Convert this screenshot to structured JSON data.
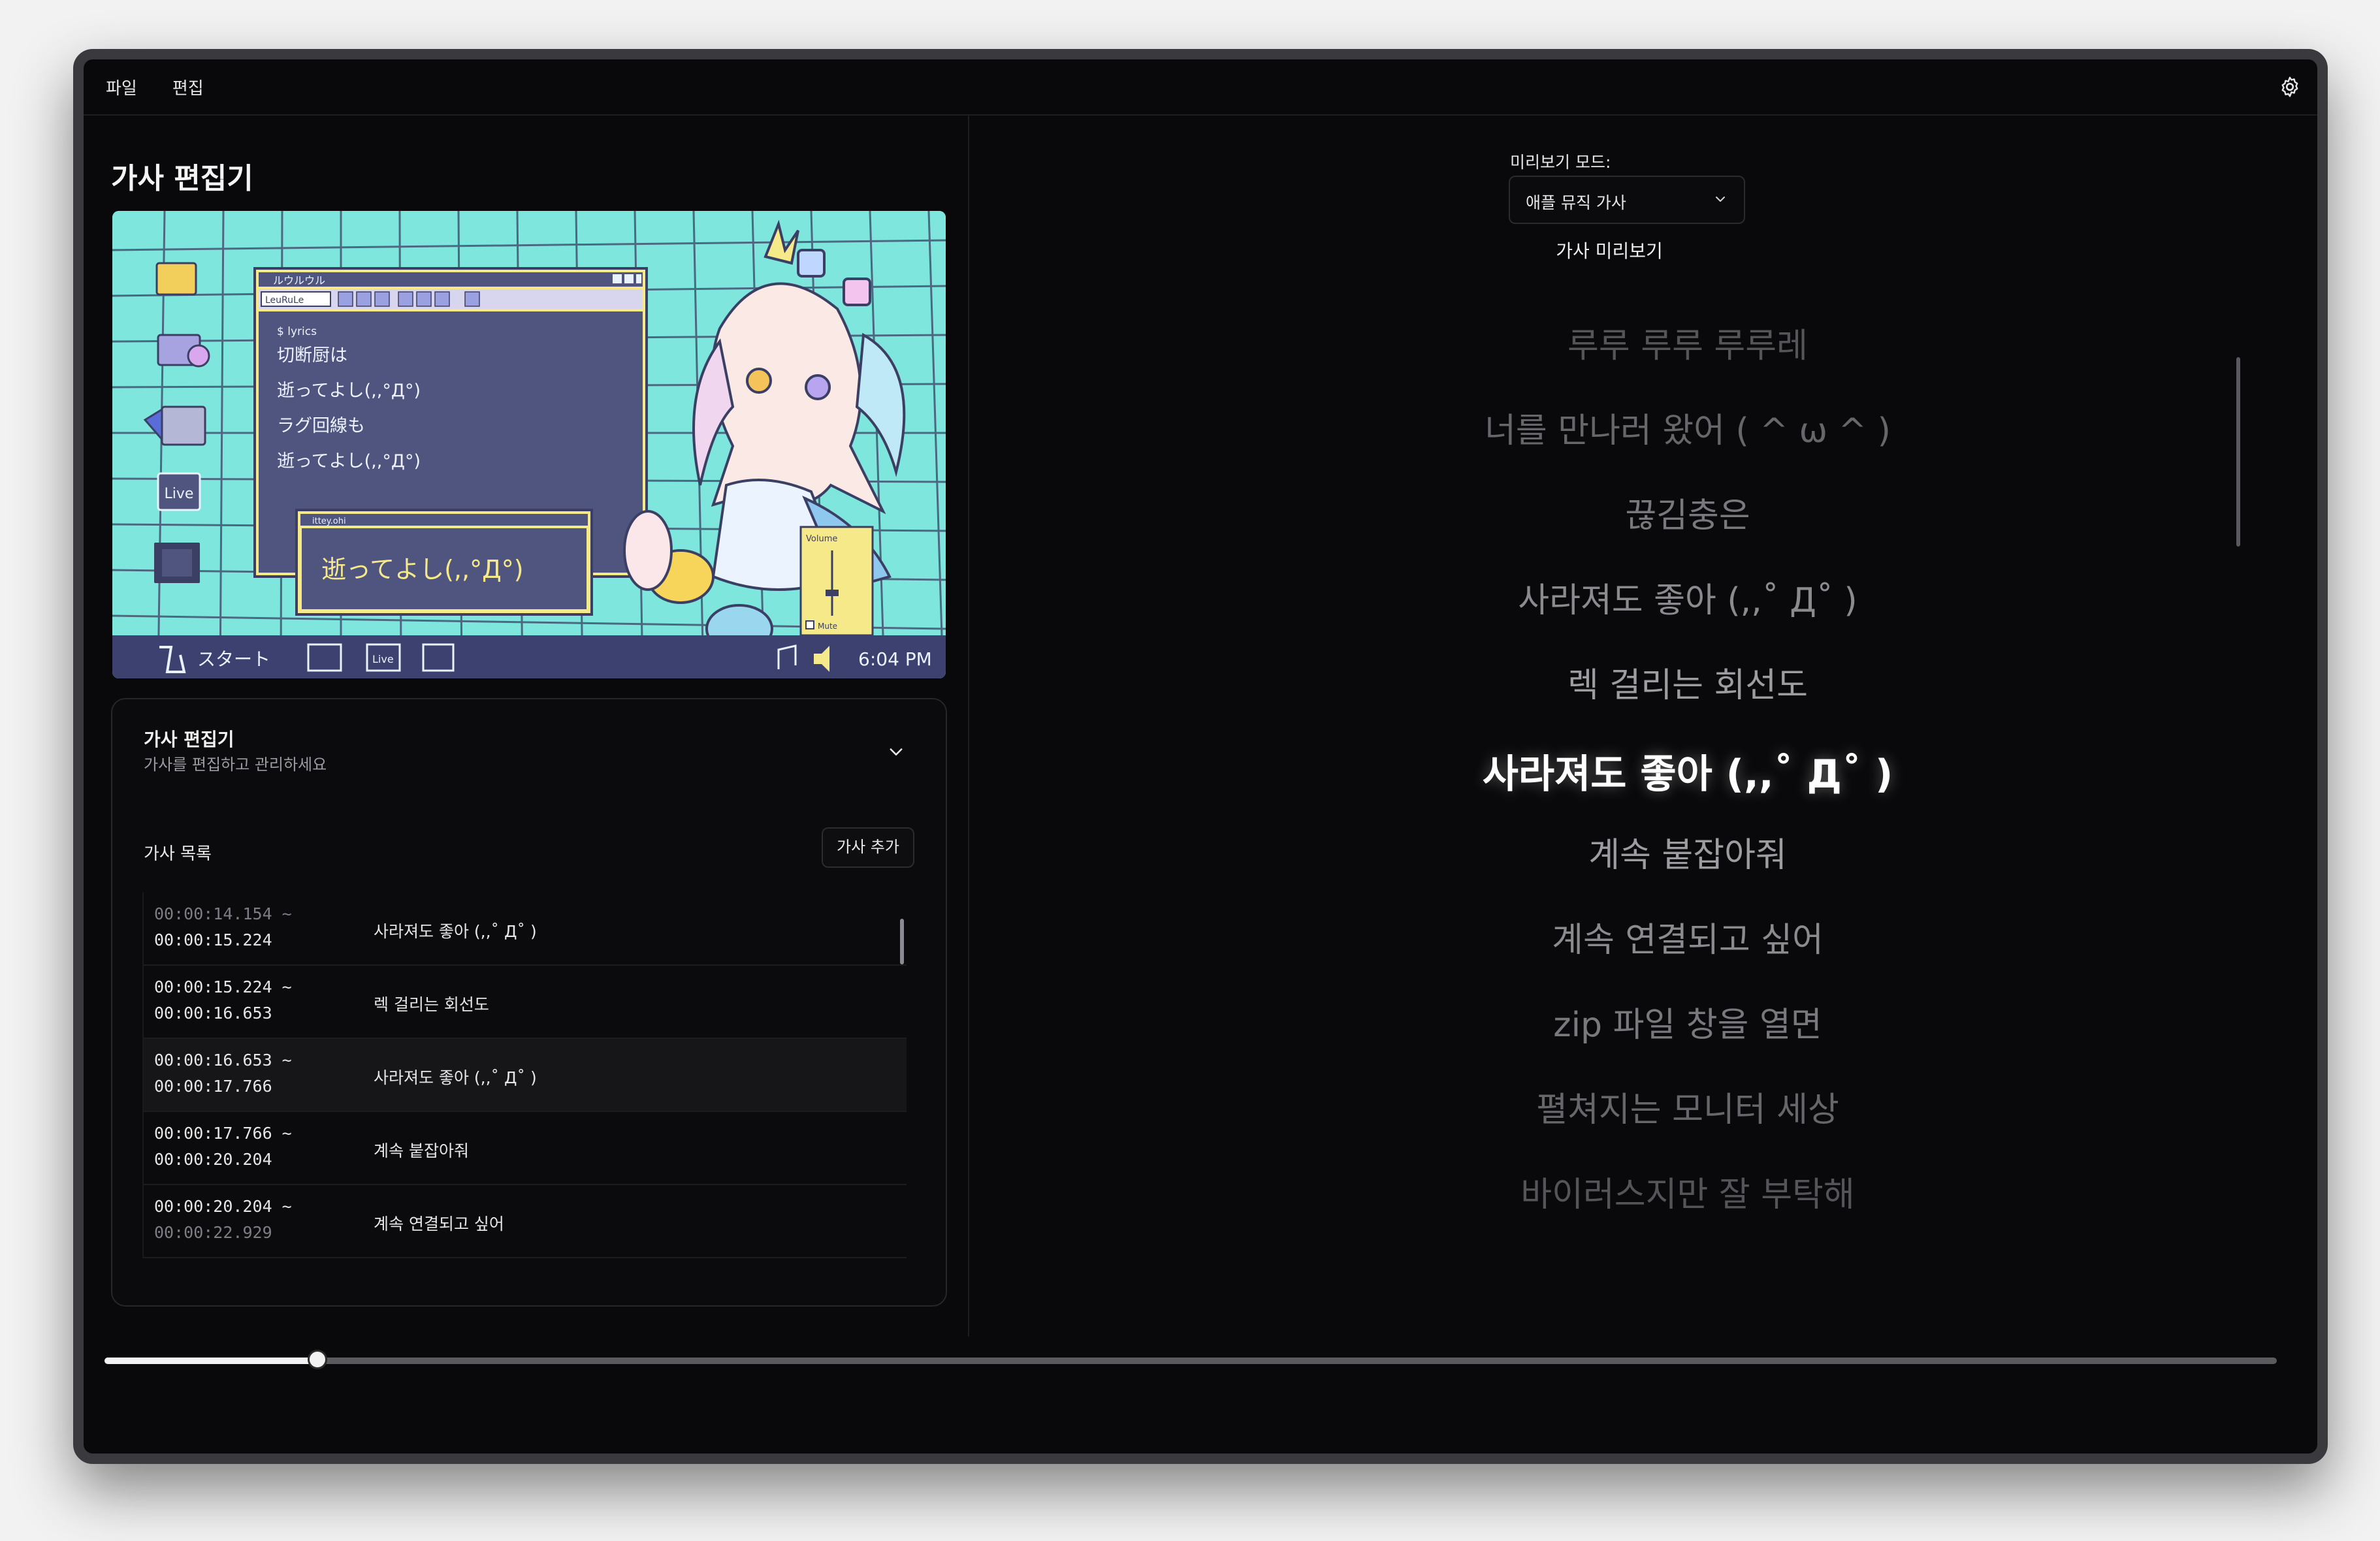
{
  "menubar": {
    "items": [
      "파일",
      "편집"
    ],
    "settings_icon": "gear-icon"
  },
  "page": {
    "title": "가사 편집기"
  },
  "artwork": {
    "window1_title": "ルウルウル",
    "window1_field": "LeuRuLe",
    "window1_lines": [
      "$ lyrics",
      "切断厨は",
      "逝ってよし(,,°Д°)",
      "ラグ回線も",
      "逝ってよし(,,°Д°)"
    ],
    "window2_title": "ittey.ohi",
    "window2_text": "逝ってよし(,,°Д°)",
    "volume_label": "Volume",
    "mute_label": "Mute",
    "desktop_live_label": "Live",
    "taskbar_start": "スタート",
    "taskbar_live": "Live",
    "taskbar_clock": "6:04 PM",
    "colors": {
      "desktop": "#7ee6dc",
      "window": "#505580",
      "window_frame": "#f6e98a",
      "taskbar": "#3d4170"
    }
  },
  "editor_card": {
    "title": "가사 편집기",
    "subtitle": "가사를 편집하고 관리하세요",
    "list_heading": "가사 목록",
    "add_button": "가사 추가",
    "rows": [
      {
        "start": "00:00:14.154 ~",
        "end": "00:00:15.224",
        "text": "사라져도 좋아 (,,˚ Д˚ )"
      },
      {
        "start": "00:00:15.224 ~",
        "end": "00:00:16.653",
        "text": "렉 걸리는 회선도"
      },
      {
        "start": "00:00:16.653 ~",
        "end": "00:00:17.766",
        "text": "사라져도 좋아 (,,˚ Д˚ )"
      },
      {
        "start": "00:00:17.766 ~",
        "end": "00:00:20.204",
        "text": "계속 붙잡아줘"
      },
      {
        "start": "00:00:20.204 ~",
        "end": "00:00:22.929",
        "text": "계속 연결되고 싶어"
      }
    ],
    "selected_row": 2
  },
  "preview": {
    "mode_label": "미리보기 모드:",
    "mode_value": "애플 뮤직 가사",
    "title": "가사 미리보기",
    "lyrics": [
      "루루 루루 루루레",
      "너를 만나러 왔어 ( ^ ω ^ )",
      "끊김충은",
      "사라져도 좋아 (,,˚ Д˚ )",
      "렉 걸리는 회선도",
      "사라져도 좋아 (,,˚ Д˚ )",
      "계속 붙잡아줘",
      "계속 연결되고 싶어",
      "zip 파일 창을 열면",
      "펼쳐지는 모니터 세상",
      "바이러스지만 잘 부탁해"
    ],
    "active_index": 5
  },
  "progress": {
    "fraction": 0.098
  }
}
